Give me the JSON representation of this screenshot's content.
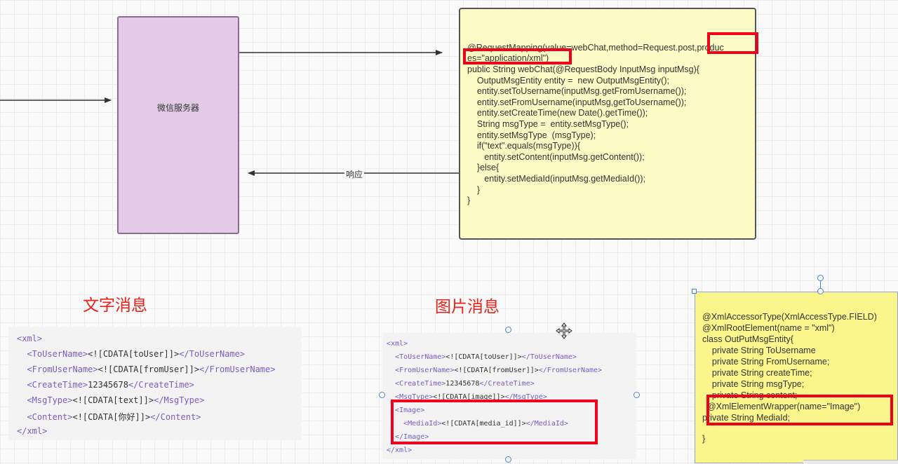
{
  "server": {
    "label": "微信服务器"
  },
  "response_label": "响应",
  "code": {
    "lines": [
      "@RequestMapping(value=webChat,method=Request.post,produc",
      "es=\"application/xml\")",
      "public String webChat(@RequestBody InputMsg inputMsg){",
      "    OutputMsgEntity entity =  new OutputMsgEntity();",
      "    entity.setToUsername(inputMsg.getFromUsername());",
      "    entity.setFromUsername(inputMsg,getToUsername());",
      "    entity.setCreateTime(new Date().getTime());",
      "    String msgType =  entity.setMsgType();",
      "    entity.setMsgType  (msgType);",
      "    if(\"text\".equals(msgType)){",
      "       entity.setContent(inputMsg.getContent());",
      "    }else{",
      "       entity.setMediaId(inputMsg.getMediaId());",
      "    }",
      "}"
    ]
  },
  "text_message": {
    "heading": "文字消息",
    "lines": [
      [
        "",
        "<xml>",
        "",
        "",
        ""
      ],
      [
        "  ",
        "<ToUserName>",
        "<![CDATA[toUser]]>",
        "</ToUserName>",
        ""
      ],
      [
        "  ",
        "<FromUserName>",
        "<![CDATA[fromUser]]>",
        "</FromUserName>",
        ""
      ],
      [
        "  ",
        "<CreateTime>",
        "12345678",
        "</CreateTime>",
        ""
      ],
      [
        "  ",
        "<MsgType>",
        "<![CDATA[text]]>",
        "</MsgType>",
        ""
      ],
      [
        "  ",
        "<Content>",
        "<![CDATA[你好]]>",
        "</Content>",
        ""
      ],
      [
        "",
        "</xml>",
        "",
        "",
        ""
      ]
    ]
  },
  "image_message": {
    "heading": "图片消息",
    "lines": [
      [
        "",
        "<xml>",
        "",
        ""
      ],
      [
        "  ",
        "<ToUserName>",
        "<![CDATA[toUser]]>",
        "</ToUserName>"
      ],
      [
        "  ",
        "<FromUserName>",
        "<![CDATA[fromUser]]>",
        "</FromUserName>"
      ],
      [
        "  ",
        "<CreateTime>",
        "12345678",
        "</CreateTime>"
      ],
      [
        "  ",
        "<MsgType>",
        "<![CDATA[image]]>",
        "</MsgType>"
      ],
      [
        "  ",
        "<Image>",
        "",
        ""
      ],
      [
        "    ",
        "<MediaId>",
        "<![CDATA[media_id]]>",
        "</MediaId>"
      ],
      [
        "  ",
        "</Image>",
        "",
        ""
      ],
      [
        "",
        "</xml>",
        "",
        ""
      ]
    ]
  },
  "entity": {
    "lines": [
      "@XmlAccessorType(XmlAccessType.FIELD)",
      "@XmlRootElement(name = \"xml\")",
      "class OutPutMsgEntity{",
      "    private String ToUsername",
      "    private String FromUsername;",
      "    private String createTime;",
      "    private String msgType;",
      "    private String content;",
      "  @XmlElementWrapper(name=\"Image\")",
      "private String MediaId;",
      "",
      "}"
    ]
  },
  "colors": {
    "highlight": "#f0001c",
    "server_fill": "#e3cbe8",
    "code_fill": "#fdfbc5",
    "entity_fill": "#fbf68c",
    "heading": "#e8221a",
    "xml_tag": "#7a5cc0"
  }
}
